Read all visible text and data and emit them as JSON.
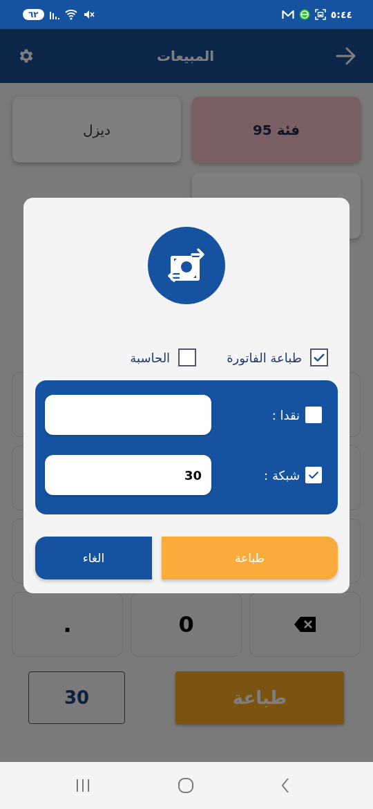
{
  "status_bar": {
    "time": "٥:٤٤",
    "battery": "٦٢"
  },
  "header": {
    "title": "المبيعات"
  },
  "products": [
    {
      "label": "فئة 95",
      "selected": true
    },
    {
      "label": "ديزل",
      "selected": false
    },
    {
      "selected": false
    }
  ],
  "keypad": [
    {
      "kind": "hidden"
    },
    {
      "kind": "hidden"
    },
    {
      "kind": "hidden"
    },
    {
      "kind": "hidden"
    },
    {
      "kind": "hidden"
    },
    {
      "kind": "hidden"
    },
    {
      "kind": "backspace"
    },
    {
      "kind": "text",
      "label": "0"
    },
    {
      "kind": "text",
      "label": "."
    }
  ],
  "total": "30",
  "print_button": "طباعة",
  "dialog": {
    "options": [
      {
        "label": "طباعة الفاتورة",
        "checked": true
      },
      {
        "label": "الحاسبة",
        "checked": false
      }
    ],
    "payments": [
      {
        "label": "نقدا :",
        "checked": false
      },
      {
        "label": "شبكة :",
        "checked": true,
        "value": "30"
      }
    ],
    "confirm": "طباعة",
    "cancel": "الغاء"
  }
}
